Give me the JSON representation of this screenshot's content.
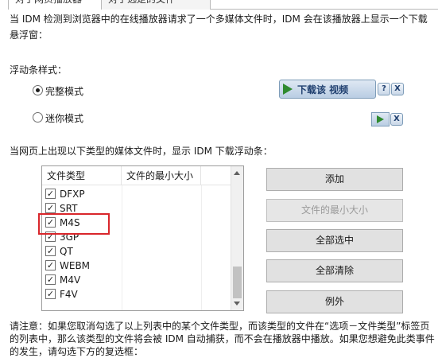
{
  "tabs": [
    {
      "label": "对于网页播放器"
    },
    {
      "label": "对于选定的文件"
    }
  ],
  "description": "当 IDM 检测到浏览器中的在线播放器请求了一个多媒体文件时，IDM 会在该播放器上显示一个下载悬浮窗：",
  "bar_style": {
    "label": "浮动条样式：",
    "options": [
      {
        "label": "完整模式",
        "checked": true
      },
      {
        "label": "迷你模式",
        "checked": false
      }
    ],
    "preview_full_text": "下载该 视频",
    "preview_help_icon": "?",
    "preview_close_icon": "X"
  },
  "media_types_label": "当网页上出现以下类型的媒体文件时，显示 IDM 下载浮动条：",
  "list": {
    "columns": [
      "文件类型",
      "文件的最小大小"
    ],
    "rows": [
      {
        "type": "DFXP",
        "checked": true
      },
      {
        "type": "SRT",
        "checked": true
      },
      {
        "type": "M4S",
        "checked": true
      },
      {
        "type": "3GP",
        "checked": true
      },
      {
        "type": "QT",
        "checked": true
      },
      {
        "type": "WEBM",
        "checked": true
      },
      {
        "type": "M4V",
        "checked": true
      },
      {
        "type": "F4V",
        "checked": true
      }
    ]
  },
  "buttons": {
    "add": "添加",
    "min_size": "文件的最小大小",
    "select_all": "全部选中",
    "clear_all": "全部清除",
    "exceptions": "例外"
  },
  "note": "请注意：如果您取消勾选了以上列表中的某个文件类型，而该类型的文件在“选项－文件类型”标签页的列表中，那么该类型的文件将会被 IDM 自动捕获，而不会在播放器中播放。如果您想避免此类事件的发生，请勾选下方的复选框："
}
